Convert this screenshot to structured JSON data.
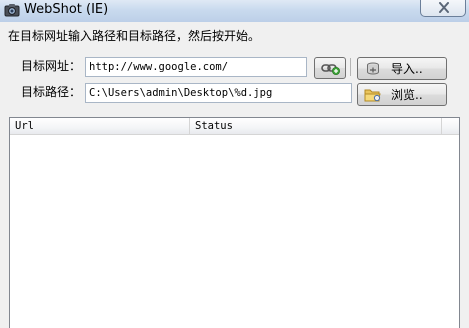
{
  "window": {
    "title": "WebShot (IE)"
  },
  "instruction": "在目标网址输入路径和目标路径，然后按开始。",
  "form": {
    "url_label": "目标网址：",
    "url_value": "http://www.google.com/",
    "path_label": "目标路径：",
    "path_value": "C:\\Users\\admin\\Desktop\\%d.jpg"
  },
  "buttons": {
    "import_label": "导入..",
    "browse_label": "浏览.."
  },
  "list": {
    "columns": [
      "Url",
      "Status"
    ],
    "rows": []
  },
  "icons": {
    "app": "camera-icon",
    "close": "close-icon",
    "add_url": "link-add-icon",
    "import": "import-icon",
    "browse": "folder-icon"
  }
}
